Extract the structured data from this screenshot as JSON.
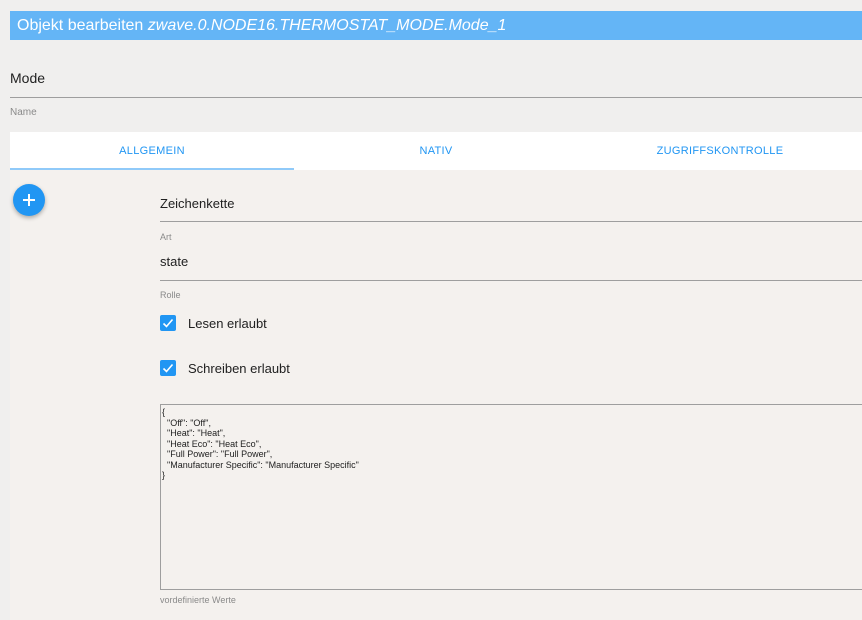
{
  "dialog": {
    "title_prefix": "Objekt bearbeiten",
    "object_id": "zwave.0.NODE16.THERMOSTAT_MODE.Mode_1"
  },
  "name_field": {
    "value": "Mode",
    "label": "Name"
  },
  "tabs": [
    {
      "label": "ALLGEMEIN",
      "active": true
    },
    {
      "label": "NATIV",
      "active": false
    },
    {
      "label": "ZUGRIFFSKONTROLLE",
      "active": false
    }
  ],
  "add_button": {
    "icon": "plus-icon"
  },
  "type_field": {
    "value": "Zeichenkette",
    "label": "Art"
  },
  "role_field": {
    "value": "state",
    "label": "Rolle"
  },
  "read_checkbox": {
    "label": "Lesen erlaubt",
    "checked": true
  },
  "write_checkbox": {
    "label": "Schreiben erlaubt",
    "checked": true
  },
  "states_field": {
    "value": "{\n  \"Off\": \"Off\",\n  \"Heat\": \"Heat\",\n  \"Heat Eco\": \"Heat Eco\",\n  \"Full Power\": \"Full Power\",\n  \"Manufacturer Specific\": \"Manufacturer Specific\"\n}",
    "label": "vordefinierte Werte"
  },
  "colors": {
    "accent": "#2196f3",
    "title_bar": "#64b5f6"
  }
}
